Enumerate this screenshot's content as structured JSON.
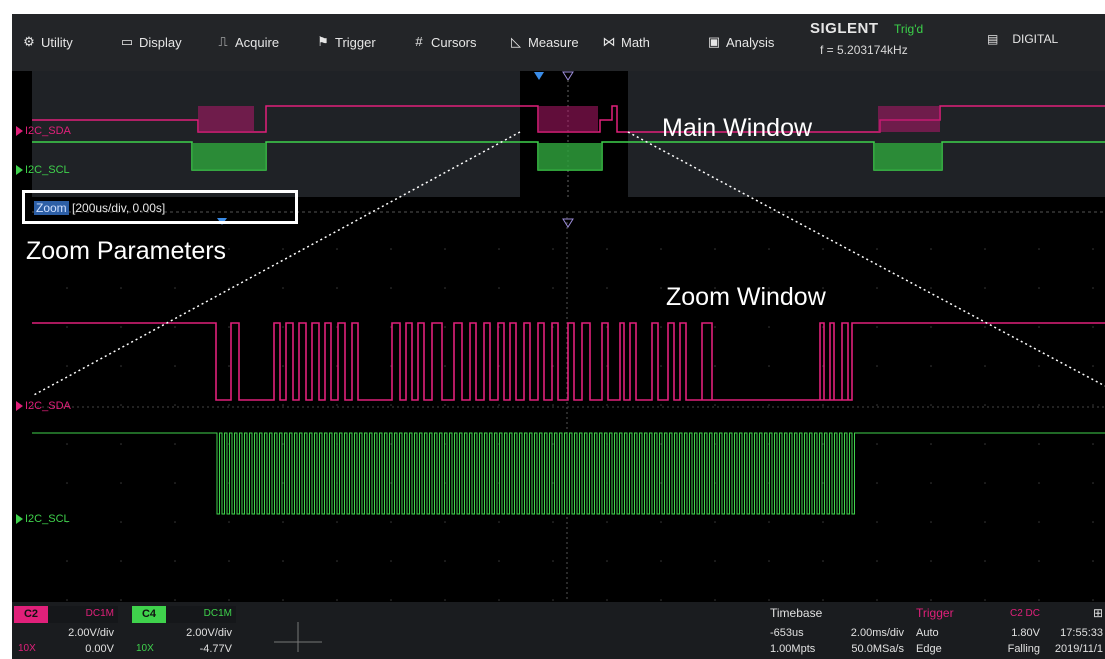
{
  "menu": {
    "items": [
      {
        "label": "Utility",
        "icon": "gear-icon"
      },
      {
        "label": "Display",
        "icon": "monitor-icon"
      },
      {
        "label": "Acquire",
        "icon": "acquire-icon"
      },
      {
        "label": "Trigger",
        "icon": "flag-icon"
      },
      {
        "label": "Cursors",
        "icon": "cursors-icon"
      },
      {
        "label": "Measure",
        "icon": "measure-icon"
      },
      {
        "label": "Math",
        "icon": "math-icon"
      },
      {
        "label": "Analysis",
        "icon": "analysis-icon"
      }
    ]
  },
  "brand": {
    "name": "SIGLENT",
    "trig_status": "Trig'd",
    "frequency": "f = 5.203174kHz"
  },
  "digital": {
    "label": "DIGITAL",
    "icon": "digital-icon"
  },
  "main_window": {
    "labels": {
      "sda": "I2C_SDA",
      "scl": "I2C_SCL"
    }
  },
  "zoom_window": {
    "labels": {
      "sda": "I2C_SDA",
      "scl": "I2C_SCL"
    }
  },
  "zoom_param": {
    "tag": "Zoom",
    "value": "[200us/div, 0.00s]"
  },
  "annotations": {
    "main_window": "Main Window",
    "zoom_window": "Zoom Window",
    "zoom_parameters": "Zoom Parameters"
  },
  "channels": [
    {
      "id": "C2",
      "coupling": "DC1M",
      "vdiv": "2.00V/div",
      "probe": "10X",
      "offset": "0.00V",
      "color": "#e0207a"
    },
    {
      "id": "C4",
      "coupling": "DC1M",
      "vdiv": "2.00V/div",
      "probe": "10X",
      "offset": "-4.77V",
      "color": "#3fd24c"
    }
  ],
  "timebase": {
    "title": "Timebase",
    "delay": "-653us",
    "tdiv": "2.00ms/div",
    "memory": "1.00Mpts",
    "sample_rate": "50.0MSa/s"
  },
  "trigger": {
    "title": "Trigger",
    "source": "C2 DC",
    "mode": "Auto",
    "level": "1.80V",
    "type": "Edge",
    "slope": "Falling"
  },
  "clock": {
    "time": "17:55:33",
    "date": "2019/11/1"
  },
  "colors": {
    "sda": "#e0207a",
    "scl": "#3fd24c",
    "trigger_text": "#e0207a",
    "trig_status": "#3bd14a"
  }
}
